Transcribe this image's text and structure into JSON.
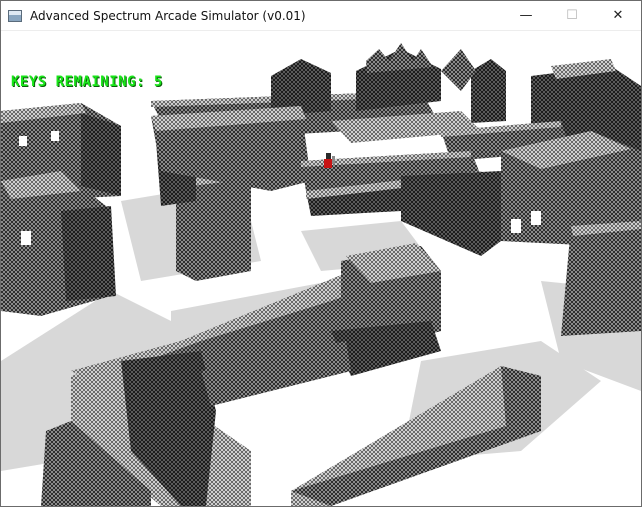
{
  "window": {
    "title": "Advanced Spectrum Arcade Simulator (v0.01)",
    "icon": "app-window-icon",
    "controls": {
      "minimize": "—",
      "maximize": "☐",
      "close": "✕"
    }
  },
  "hud": {
    "keys_remaining": "KEYS REMAINING: 5"
  },
  "colors": {
    "hud_text": "#19e619",
    "floor": "#ffffff",
    "block_top": "#a8a8a8",
    "block_side_light": "#7a7a7a",
    "block_side_dark": "#3a3a3a",
    "shadow": "#d6d6d6",
    "player_red": "#c81414"
  }
}
